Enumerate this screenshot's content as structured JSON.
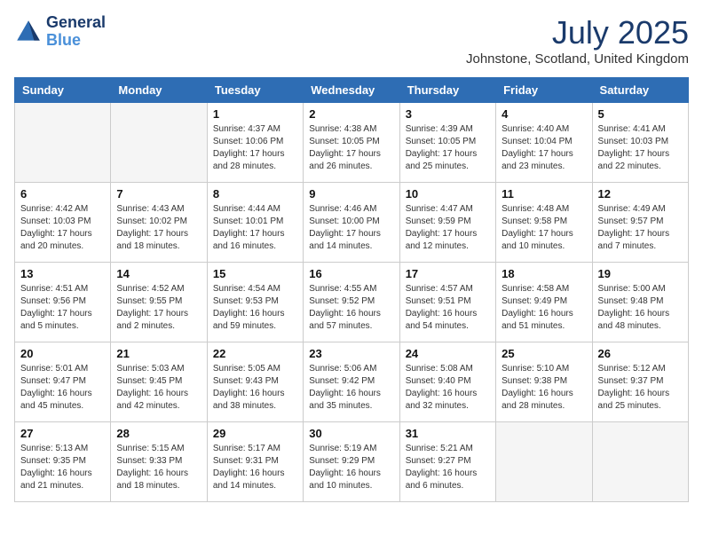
{
  "header": {
    "logo_line1": "General",
    "logo_line2": "Blue",
    "month_year": "July 2025",
    "location": "Johnstone, Scotland, United Kingdom"
  },
  "days_of_week": [
    "Sunday",
    "Monday",
    "Tuesday",
    "Wednesday",
    "Thursday",
    "Friday",
    "Saturday"
  ],
  "weeks": [
    [
      {
        "day": "",
        "sunrise": "",
        "sunset": "",
        "daylight": ""
      },
      {
        "day": "",
        "sunrise": "",
        "sunset": "",
        "daylight": ""
      },
      {
        "day": "1",
        "sunrise": "Sunrise: 4:37 AM",
        "sunset": "Sunset: 10:06 PM",
        "daylight": "Daylight: 17 hours and 28 minutes."
      },
      {
        "day": "2",
        "sunrise": "Sunrise: 4:38 AM",
        "sunset": "Sunset: 10:05 PM",
        "daylight": "Daylight: 17 hours and 26 minutes."
      },
      {
        "day": "3",
        "sunrise": "Sunrise: 4:39 AM",
        "sunset": "Sunset: 10:05 PM",
        "daylight": "Daylight: 17 hours and 25 minutes."
      },
      {
        "day": "4",
        "sunrise": "Sunrise: 4:40 AM",
        "sunset": "Sunset: 10:04 PM",
        "daylight": "Daylight: 17 hours and 23 minutes."
      },
      {
        "day": "5",
        "sunrise": "Sunrise: 4:41 AM",
        "sunset": "Sunset: 10:03 PM",
        "daylight": "Daylight: 17 hours and 22 minutes."
      }
    ],
    [
      {
        "day": "6",
        "sunrise": "Sunrise: 4:42 AM",
        "sunset": "Sunset: 10:03 PM",
        "daylight": "Daylight: 17 hours and 20 minutes."
      },
      {
        "day": "7",
        "sunrise": "Sunrise: 4:43 AM",
        "sunset": "Sunset: 10:02 PM",
        "daylight": "Daylight: 17 hours and 18 minutes."
      },
      {
        "day": "8",
        "sunrise": "Sunrise: 4:44 AM",
        "sunset": "Sunset: 10:01 PM",
        "daylight": "Daylight: 17 hours and 16 minutes."
      },
      {
        "day": "9",
        "sunrise": "Sunrise: 4:46 AM",
        "sunset": "Sunset: 10:00 PM",
        "daylight": "Daylight: 17 hours and 14 minutes."
      },
      {
        "day": "10",
        "sunrise": "Sunrise: 4:47 AM",
        "sunset": "Sunset: 9:59 PM",
        "daylight": "Daylight: 17 hours and 12 minutes."
      },
      {
        "day": "11",
        "sunrise": "Sunrise: 4:48 AM",
        "sunset": "Sunset: 9:58 PM",
        "daylight": "Daylight: 17 hours and 10 minutes."
      },
      {
        "day": "12",
        "sunrise": "Sunrise: 4:49 AM",
        "sunset": "Sunset: 9:57 PM",
        "daylight": "Daylight: 17 hours and 7 minutes."
      }
    ],
    [
      {
        "day": "13",
        "sunrise": "Sunrise: 4:51 AM",
        "sunset": "Sunset: 9:56 PM",
        "daylight": "Daylight: 17 hours and 5 minutes."
      },
      {
        "day": "14",
        "sunrise": "Sunrise: 4:52 AM",
        "sunset": "Sunset: 9:55 PM",
        "daylight": "Daylight: 17 hours and 2 minutes."
      },
      {
        "day": "15",
        "sunrise": "Sunrise: 4:54 AM",
        "sunset": "Sunset: 9:53 PM",
        "daylight": "Daylight: 16 hours and 59 minutes."
      },
      {
        "day": "16",
        "sunrise": "Sunrise: 4:55 AM",
        "sunset": "Sunset: 9:52 PM",
        "daylight": "Daylight: 16 hours and 57 minutes."
      },
      {
        "day": "17",
        "sunrise": "Sunrise: 4:57 AM",
        "sunset": "Sunset: 9:51 PM",
        "daylight": "Daylight: 16 hours and 54 minutes."
      },
      {
        "day": "18",
        "sunrise": "Sunrise: 4:58 AM",
        "sunset": "Sunset: 9:49 PM",
        "daylight": "Daylight: 16 hours and 51 minutes."
      },
      {
        "day": "19",
        "sunrise": "Sunrise: 5:00 AM",
        "sunset": "Sunset: 9:48 PM",
        "daylight": "Daylight: 16 hours and 48 minutes."
      }
    ],
    [
      {
        "day": "20",
        "sunrise": "Sunrise: 5:01 AM",
        "sunset": "Sunset: 9:47 PM",
        "daylight": "Daylight: 16 hours and 45 minutes."
      },
      {
        "day": "21",
        "sunrise": "Sunrise: 5:03 AM",
        "sunset": "Sunset: 9:45 PM",
        "daylight": "Daylight: 16 hours and 42 minutes."
      },
      {
        "day": "22",
        "sunrise": "Sunrise: 5:05 AM",
        "sunset": "Sunset: 9:43 PM",
        "daylight": "Daylight: 16 hours and 38 minutes."
      },
      {
        "day": "23",
        "sunrise": "Sunrise: 5:06 AM",
        "sunset": "Sunset: 9:42 PM",
        "daylight": "Daylight: 16 hours and 35 minutes."
      },
      {
        "day": "24",
        "sunrise": "Sunrise: 5:08 AM",
        "sunset": "Sunset: 9:40 PM",
        "daylight": "Daylight: 16 hours and 32 minutes."
      },
      {
        "day": "25",
        "sunrise": "Sunrise: 5:10 AM",
        "sunset": "Sunset: 9:38 PM",
        "daylight": "Daylight: 16 hours and 28 minutes."
      },
      {
        "day": "26",
        "sunrise": "Sunrise: 5:12 AM",
        "sunset": "Sunset: 9:37 PM",
        "daylight": "Daylight: 16 hours and 25 minutes."
      }
    ],
    [
      {
        "day": "27",
        "sunrise": "Sunrise: 5:13 AM",
        "sunset": "Sunset: 9:35 PM",
        "daylight": "Daylight: 16 hours and 21 minutes."
      },
      {
        "day": "28",
        "sunrise": "Sunrise: 5:15 AM",
        "sunset": "Sunset: 9:33 PM",
        "daylight": "Daylight: 16 hours and 18 minutes."
      },
      {
        "day": "29",
        "sunrise": "Sunrise: 5:17 AM",
        "sunset": "Sunset: 9:31 PM",
        "daylight": "Daylight: 16 hours and 14 minutes."
      },
      {
        "day": "30",
        "sunrise": "Sunrise: 5:19 AM",
        "sunset": "Sunset: 9:29 PM",
        "daylight": "Daylight: 16 hours and 10 minutes."
      },
      {
        "day": "31",
        "sunrise": "Sunrise: 5:21 AM",
        "sunset": "Sunset: 9:27 PM",
        "daylight": "Daylight: 16 hours and 6 minutes."
      },
      {
        "day": "",
        "sunrise": "",
        "sunset": "",
        "daylight": ""
      },
      {
        "day": "",
        "sunrise": "",
        "sunset": "",
        "daylight": ""
      }
    ]
  ]
}
